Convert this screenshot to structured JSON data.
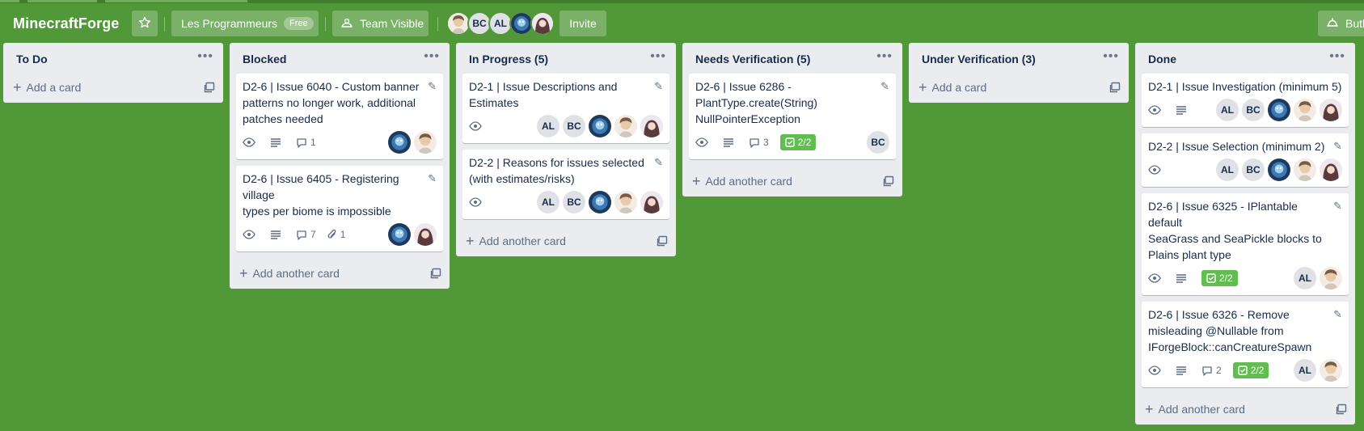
{
  "board": {
    "title": "MinecraftForge",
    "team": "Les Programmeurs",
    "team_badge": "Free",
    "visibility": "Team Visible",
    "invite": "Invite",
    "butler": "Butler",
    "members": [
      "BC",
      "AL"
    ]
  },
  "colors": {
    "background": "#519839",
    "list": "#ebecf0",
    "checklist_done": "#61bd4f"
  },
  "lists": [
    {
      "title": "To Do",
      "add_label": "Add a card",
      "cards": []
    },
    {
      "title": "Blocked",
      "add_label": "Add another card",
      "cards": [
        {
          "title": "D2-6 | Issue 6040 - Custom banner\npatterns no longer work, additional\npatches needed",
          "comments": "1"
        },
        {
          "title": "D2-6 | Issue 6405 - Registering village\ntypes per biome is impossible",
          "comments": "7",
          "attachments": "1"
        }
      ]
    },
    {
      "title": "In Progress (5)",
      "add_label": "Add another card",
      "cards": [
        {
          "title": "D2-1 | Issue Descriptions and\nEstimates"
        },
        {
          "title": "D2-2 | Reasons for issues selected\n(with estimates/risks)"
        }
      ]
    },
    {
      "title": "Needs Verification (5)",
      "add_label": "Add another card",
      "cards": [
        {
          "title": "D2-6 | Issue 6286 -\nPlantType.create(String)\nNullPointerException",
          "comments": "3",
          "checklist": "2/2"
        }
      ]
    },
    {
      "title": "Under Verification (3)",
      "add_label": "Add a card",
      "cards": []
    },
    {
      "title": "Done",
      "add_label": "Add another card",
      "cards": [
        {
          "title": "D2-1 | Issue Investigation (minimum 5)"
        },
        {
          "title": "D2-2 | Issue Selection (minimum 2)"
        },
        {
          "title": "D2-6 | Issue 6325 - IPlantable default\nSeaGrass and SeaPickle blocks to\nPlains plant type",
          "checklist": "2/2"
        },
        {
          "title": "D2-6 | Issue 6326 - Remove\nmisleading @Nullable from\nIForgeBlock::canCreatureSpawn",
          "comments": "2",
          "checklist": "2/2"
        }
      ]
    }
  ],
  "avatar_initials": {
    "al": "AL",
    "bc": "BC"
  }
}
